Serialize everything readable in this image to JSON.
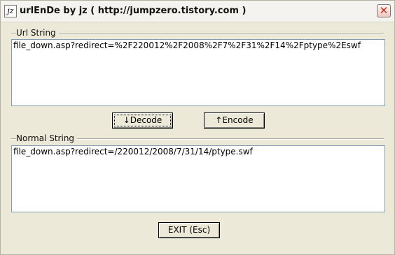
{
  "window": {
    "title": "urlEnDe by jz ( http://jumpzero.tistory.com )",
    "icon_glyph": "jz"
  },
  "url_group": {
    "title": "Url String",
    "value": "file_down.asp?redirect=%2F220012%2F2008%2F7%2F31%2F14%2Fptype%2Eswf"
  },
  "buttons": {
    "decode": "↓Decode",
    "encode": "↑Encode",
    "exit": "EXIT (Esc)"
  },
  "normal_group": {
    "title": "Normal String",
    "value": "file_down.asp?redirect=/220012/2008/7/31/14/ptype.swf"
  }
}
